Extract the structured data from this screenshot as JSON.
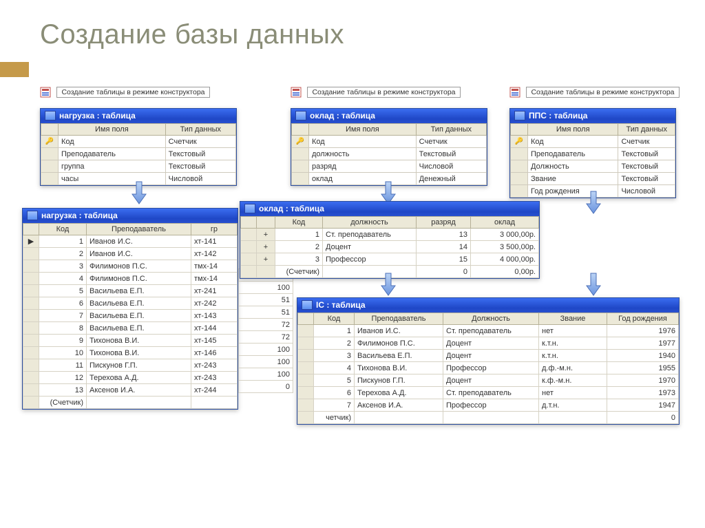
{
  "title": "Создание базы данных",
  "link_label": "Создание таблицы в режиме конструктора",
  "design_headers": {
    "name": "Имя поля",
    "type": "Тип данных"
  },
  "nagruzka_design": {
    "title": "нагрузка : таблица",
    "rows": [
      {
        "key": "🔑",
        "name": "Код",
        "type": "Счетчик"
      },
      {
        "key": "",
        "name": "Преподаватель",
        "type": "Текстовый"
      },
      {
        "key": "",
        "name": "группа",
        "type": "Текстовый"
      },
      {
        "key": "",
        "name": "часы",
        "type": "Числовой"
      }
    ]
  },
  "oklad_design": {
    "title": "оклад : таблица",
    "rows": [
      {
        "key": "🔑",
        "name": "Код",
        "type": "Счетчик"
      },
      {
        "key": "",
        "name": "должность",
        "type": "Текстовый"
      },
      {
        "key": "",
        "name": "разряд",
        "type": "Числовой"
      },
      {
        "key": "",
        "name": "оклад",
        "type": "Денежный"
      }
    ]
  },
  "pps_design": {
    "title": "ППС : таблица",
    "rows": [
      {
        "key": "🔑",
        "name": "Код",
        "type": "Счетчик"
      },
      {
        "key": "",
        "name": "Преподаватель",
        "type": "Текстовый"
      },
      {
        "key": "",
        "name": "Должность",
        "type": "Текстовый"
      },
      {
        "key": "",
        "name": "Звание",
        "type": "Текстовый"
      },
      {
        "key": "",
        "name": "Год рождения",
        "type": "Числовой"
      }
    ]
  },
  "nagruzka_sheet": {
    "title": "нагрузка : таблица",
    "headers": [
      "Код",
      "Преподаватель",
      "гр"
    ],
    "rows": [
      [
        "1",
        "Иванов И.С.",
        "хт-141"
      ],
      [
        "2",
        "Иванов И.С.",
        "хт-142"
      ],
      [
        "3",
        "Филимонов П.С.",
        "тмх-14"
      ],
      [
        "4",
        "Филимонов П.С.",
        "тмх-14"
      ],
      [
        "5",
        "Васильева Е.П.",
        "хт-241"
      ],
      [
        "6",
        "Васильева Е.П.",
        "хт-242"
      ],
      [
        "7",
        "Васильева Е.П.",
        "хт-143"
      ],
      [
        "8",
        "Васильева Е.П.",
        "хт-144"
      ],
      [
        "9",
        "Тихонова В.И.",
        "хт-145"
      ],
      [
        "10",
        "Тихонова В.И.",
        "хт-146"
      ],
      [
        "11",
        "Пискунов Г.П.",
        "хт-243"
      ],
      [
        "12",
        "Терехова А.Д.",
        "хт-243"
      ],
      [
        "13",
        "Аксенов И.А.",
        "хт-244"
      ]
    ],
    "last": [
      "(Счетчик)",
      "",
      ""
    ],
    "numcol": [
      "100",
      "100",
      "51",
      "51",
      "72",
      "72",
      "100",
      "100",
      "100",
      "0"
    ]
  },
  "oklad_sheet": {
    "title": "оклад : таблица",
    "headers": [
      "Код",
      "должность",
      "разряд",
      "оклад"
    ],
    "rows": [
      [
        "1",
        "Ст. преподаватель",
        "13",
        "3 000,00р."
      ],
      [
        "2",
        "Доцент",
        "14",
        "3 500,00р."
      ],
      [
        "3",
        "Профессор",
        "15",
        "4 000,00р."
      ]
    ],
    "last": [
      "(Счетчик)",
      "",
      "0",
      "0,00р."
    ]
  },
  "pps_sheet": {
    "title_fragment": "ІС : таблица",
    "headers": [
      "Код",
      "Преподаватель",
      "Должность",
      "Звание",
      "Год рождения"
    ],
    "rows": [
      [
        "1",
        "Иванов И.С.",
        "Ст. преподаватель",
        "нет",
        "1976"
      ],
      [
        "2",
        "Филимонов П.С.",
        "Доцент",
        "к.т.н.",
        "1977"
      ],
      [
        "3",
        "Васильева Е.П.",
        "Доцент",
        "к.т.н.",
        "1940"
      ],
      [
        "4",
        "Тихонова В.И.",
        "Профессор",
        "д.ф.-м.н.",
        "1955"
      ],
      [
        "5",
        "Пискунов Г.П.",
        "Доцент",
        "к.ф.-м.н.",
        "1970"
      ],
      [
        "6",
        "Терехова А.Д.",
        "Ст. преподаватель",
        "нет",
        "1973"
      ],
      [
        "7",
        "Аксенов И.А.",
        "Профессор",
        "д.т.н.",
        "1947"
      ]
    ],
    "last": [
      "четчик)",
      "",
      "",
      "",
      "0"
    ]
  }
}
